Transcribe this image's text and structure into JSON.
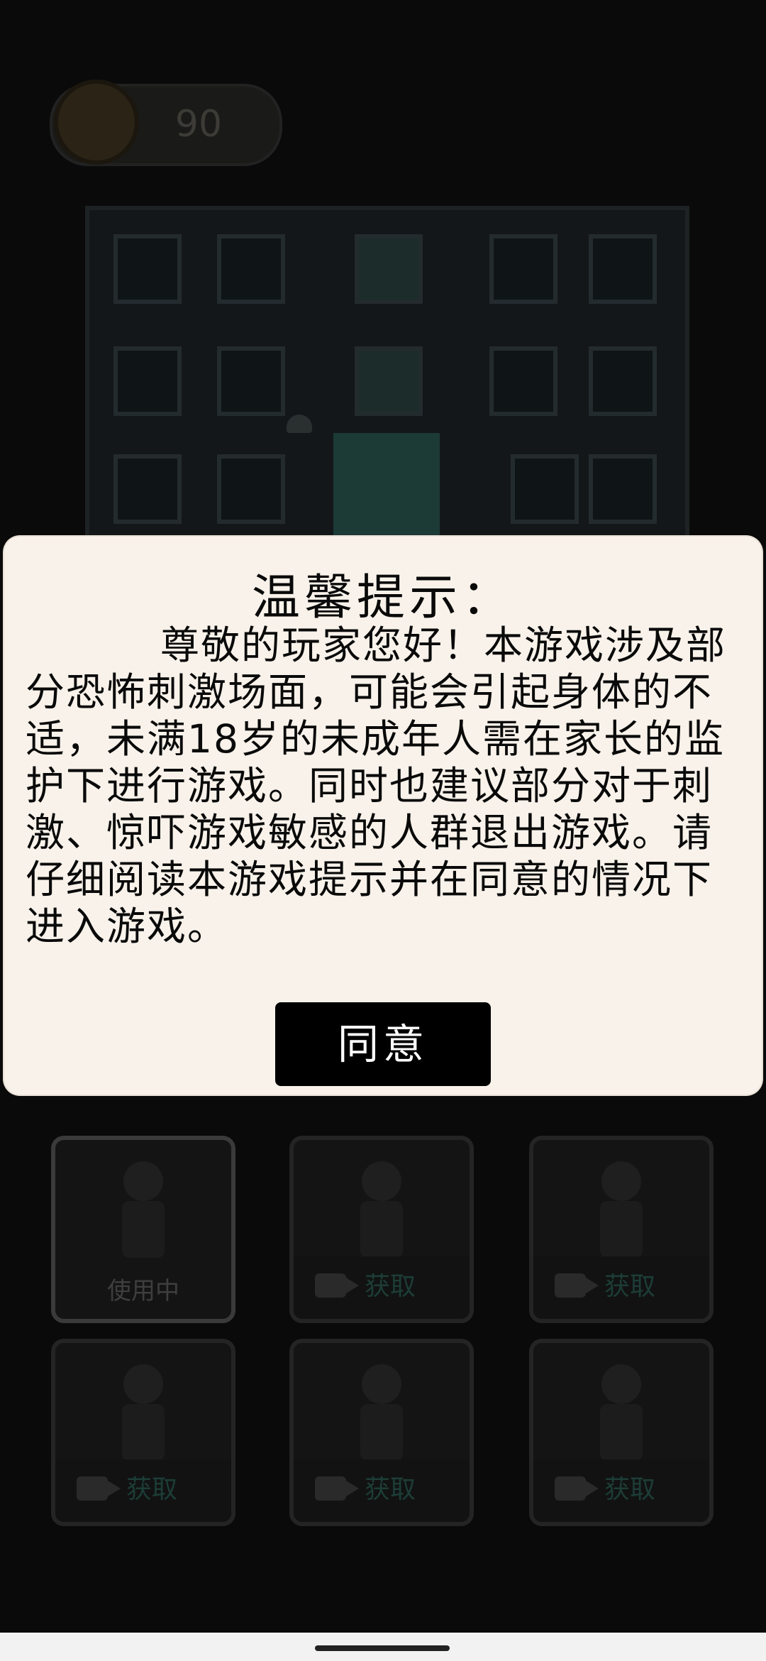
{
  "hud": {
    "coin_count": "90"
  },
  "dialog": {
    "title": "温馨提示：",
    "body": "尊敬的玩家您好！本游戏涉及部分恐怖刺激场面，可能会引起身体的不适，未满18岁的未成年人需在家长的监护下进行游戏。同时也建议部分对于刺激、惊吓游戏敏感的人群退出游戏。请仔细阅读本游戏提示并在同意的情况下进入游戏。",
    "agree_label": "同意"
  },
  "characters": [
    {
      "status": "使用中",
      "icon": "video-icon"
    },
    {
      "status": "获取",
      "icon": "video-icon"
    },
    {
      "status": "获取",
      "icon": "video-icon"
    },
    {
      "status": "获取",
      "icon": "video-icon"
    },
    {
      "status": "获取",
      "icon": "video-icon"
    },
    {
      "status": "获取",
      "icon": "video-icon"
    }
  ],
  "colors": {
    "dialog_bg": "#f8f2ea",
    "button_bg": "#000000",
    "button_text": "#ffffff"
  }
}
